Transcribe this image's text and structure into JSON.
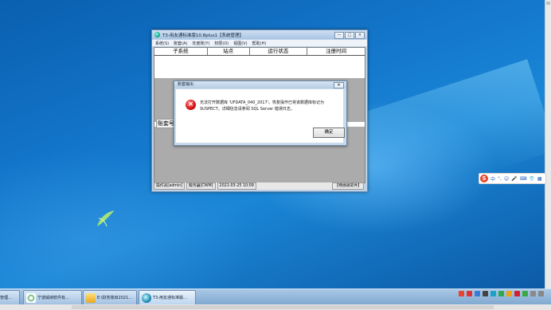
{
  "window": {
    "title": "T3-用友通标准版10.8plus1【系统管理】",
    "controls": [
      "—",
      "□",
      "✕"
    ],
    "menu": [
      "系统(S)",
      "账套(A)",
      "年度账(Y)",
      "权限(O)",
      "视图(V)",
      "帮助(H)"
    ],
    "table_headers": [
      "子系统",
      "站点",
      "运行状态",
      "注册时间"
    ],
    "account_label": "账套号",
    "status": [
      "操作员[admin]",
      "服务器[CWM]",
      "2021-03-25 10:09",
      "【畅捷通软件】"
    ]
  },
  "dialog": {
    "title": "账套输出",
    "close": "✕",
    "message": "无法打开数据库 'UFDATA_040_2017'。恢复操作已将该数据库标记为 SUSPECT。详细信息请参阅 SQL Server 错误日志。",
    "ok_label": "确定"
  },
  "ime": {
    "logo": "S",
    "label": "中",
    "icons": [
      "°,",
      "☺",
      "🎤",
      "⌨",
      "👕",
      "▦"
    ]
  },
  "taskbar": {
    "items": [
      {
        "label": "管理...",
        "icon": "folder-icon"
      },
      {
        "label": "宁波威纳软件有...",
        "icon": "browser-icon"
      },
      {
        "label": "E:\\财务账目2021...",
        "icon": "folder-icon"
      },
      {
        "label": "T3-用友通标准版...",
        "icon": "app-icon"
      }
    ]
  },
  "colors": {
    "error": "#d31010",
    "ime_logo": "#e8452c",
    "desktop": "#1478cc"
  }
}
